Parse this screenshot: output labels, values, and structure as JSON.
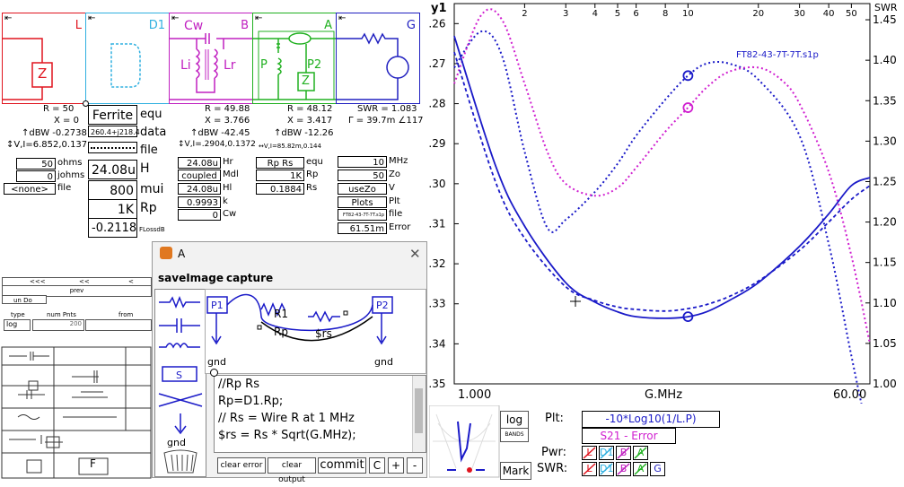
{
  "blocks": [
    {
      "title": "L",
      "color": "#e0141e"
    },
    {
      "title": "D1",
      "color": "#30b0e0"
    },
    {
      "title": "B",
      "color": "#c020c0"
    },
    {
      "title": "A",
      "color": "#20b020"
    },
    {
      "title": "G",
      "color": "#2020c0"
    }
  ],
  "block_labels": {
    "cw": "Cw",
    "li": "Li",
    "lr": "Lr",
    "p": "P",
    "p2": "P2",
    "z": "Z"
  },
  "results": {
    "L": [
      "R = 50",
      "X = 0",
      "↑dBW -0.2738",
      "↕V,I=6.852,0.137"
    ],
    "B": [
      "R = 49.88",
      "X = 3.766",
      "↑dBW -42.45",
      "↕V,I=.2904,0.1372"
    ],
    "A": [
      "R = 48.12",
      "X = 3.417",
      "↑dBW -12.26",
      "↔V,I=85.82m,0.144"
    ],
    "G": [
      "SWR = 1.083",
      "Γ = 39.7m ∠117"
    ]
  },
  "L_params": [
    {
      "value": "50",
      "unit": "ohms"
    },
    {
      "value": "0",
      "unit": "johms"
    },
    {
      "value": "<none>",
      "unit": "file"
    }
  ],
  "D1_params": {
    "material": "Ferrite",
    "material_unit": "equ",
    "data": "260.4+j218.4",
    "data_unit": "data",
    "file_unit": "file",
    "H": "24.08u",
    "H_unit": "H",
    "mui": "800",
    "mui_unit": "mui",
    "Rp": "1K",
    "Rp_unit": "Rp",
    "loss": "-0.2118",
    "loss_unit": "FLossdB"
  },
  "B_params": [
    {
      "value": "24.08u",
      "unit": "Hr"
    },
    {
      "value": "coupled",
      "unit": "Mdl"
    },
    {
      "value": "24.08u",
      "unit": "Hl"
    },
    {
      "value": "0.9993",
      "unit": "k"
    },
    {
      "value": "0",
      "unit": "Cw"
    }
  ],
  "A_params": [
    {
      "value": "Rp Rs",
      "unit": "equ"
    },
    {
      "value": "1K",
      "unit": "Rp"
    },
    {
      "value": "0.1884",
      "unit": "Rs"
    }
  ],
  "G_params": [
    {
      "value": "10",
      "unit": "MHz"
    },
    {
      "value": "50",
      "unit": "Zo"
    },
    {
      "value": "useZo",
      "unit": "V"
    },
    {
      "value": "Plots",
      "unit": "Plt"
    },
    {
      "value": "FT82-43-7T-7T.s1p",
      "unit": "file"
    },
    {
      "value": "61.51m",
      "unit": "Error"
    }
  ],
  "left_panel": {
    "row1": [
      "<<<",
      "<<",
      "<"
    ],
    "prev": "prev",
    "undo": "un Do",
    "type_lbl": "type",
    "type_val": "log",
    "pnts_lbl": "num Pnts",
    "pnts_val": "200",
    "from_lbl": "from"
  },
  "dialog": {
    "title": "A",
    "menu": [
      "saveImage",
      "capture"
    ],
    "schem": {
      "p1": "P1",
      "p2": "P2",
      "r1": "R1",
      "rp": "Rp",
      "rs": "$rs",
      "gnd1": "gnd",
      "gnd2": "gnd"
    },
    "palette_s": "S",
    "palette_gnd": "gnd",
    "code": [
      "//Rp Rs",
      "Rp=D1.Rp;",
      "// Rs = Wire R at 1 MHz",
      "$rs = Rs * Sqrt(G.MHz);"
    ],
    "buttons": [
      "clear error",
      "clear output",
      "commit",
      "C",
      "+",
      "-"
    ]
  },
  "chart_data": {
    "type": "line",
    "x_scale": "log",
    "xlabel": "G.MHz",
    "x_range": [
      1.0,
      60.0
    ],
    "x_end_labels": [
      "1.000",
      "60.00"
    ],
    "x_ticks": [
      "2",
      "3",
      "4",
      "5",
      "6",
      "8",
      "10",
      "20",
      "30",
      "40",
      "50"
    ],
    "y1_label": "y1",
    "y1_range": [
      -0.35,
      -0.255
    ],
    "y1_ticks": [
      "-0.26",
      "-0.27",
      "-0.28",
      "-0.29",
      "-0.30",
      "-0.31",
      "-0.32",
      "-0.33",
      "-0.34",
      "-0.35"
    ],
    "y2_label": "SWR",
    "y2_range": [
      1.0,
      1.47
    ],
    "y2_ticks": [
      "1.45",
      "1.40",
      "1.35",
      "1.30",
      "1.25",
      "1.20",
      "1.15",
      "1.10",
      "1.05",
      "1.00"
    ],
    "annotation": "FT82-43-7T-7T.s1p",
    "marker_x": 10,
    "grid": false,
    "series": [
      {
        "name": "-10*Log10(1/L.P)",
        "axis": "y1",
        "style": "dotted",
        "color": "#1a1ac8",
        "x": [
          1.0,
          1.3,
          1.6,
          2.0,
          2.5,
          3.0,
          4.0,
          5.0,
          6.0,
          8.0,
          10,
          12,
          15,
          20,
          30,
          40,
          50,
          60
        ],
        "y": [
          -0.271,
          -0.262,
          -0.268,
          -0.292,
          -0.311,
          -0.309,
          -0.302,
          -0.295,
          -0.288,
          -0.279,
          -0.273,
          -0.27,
          -0.27,
          -0.274,
          -0.288,
          -0.315,
          -0.343,
          -0.365
        ]
      },
      {
        "name": "S21 - Error",
        "axis": "y1",
        "style": "dotted",
        "color": "#d020d0",
        "x": [
          1.0,
          1.3,
          1.6,
          2.0,
          2.5,
          3.0,
          4.0,
          5.0,
          6.0,
          8.0,
          10,
          12,
          15,
          20,
          25,
          30,
          40,
          50,
          60
        ],
        "y": [
          -0.275,
          -0.258,
          -0.259,
          -0.275,
          -0.292,
          -0.3,
          -0.303,
          -0.301,
          -0.296,
          -0.287,
          -0.281,
          -0.276,
          -0.272,
          -0.271,
          -0.274,
          -0.28,
          -0.297,
          -0.318,
          -0.34
        ]
      },
      {
        "name": "SWR",
        "axis": "y2",
        "style": "solid",
        "color": "#1a1ac8",
        "x": [
          1.0,
          1.5,
          2.0,
          3.0,
          4.0,
          5.0,
          6.0,
          8.0,
          10,
          12,
          15,
          20,
          30,
          40,
          50,
          60
        ],
        "y": [
          1.43,
          1.27,
          1.195,
          1.125,
          1.101,
          1.089,
          1.083,
          1.081,
          1.083,
          1.089,
          1.103,
          1.125,
          1.17,
          1.21,
          1.245,
          1.255
        ]
      },
      {
        "name": "SWR ref",
        "axis": "y2",
        "style": "dashed",
        "color": "#1a1ac8",
        "x": [
          1.0,
          1.5,
          2.0,
          3.0,
          4.0,
          5.0,
          6.0,
          8.0,
          10,
          12,
          15,
          20,
          30,
          40,
          50,
          60
        ],
        "y": [
          1.41,
          1.25,
          1.18,
          1.12,
          1.103,
          1.095,
          1.092,
          1.09,
          1.093,
          1.098,
          1.108,
          1.127,
          1.165,
          1.2,
          1.228,
          1.245
        ]
      }
    ]
  },
  "bottom": {
    "log": "log",
    "bands": "BANDS",
    "mark": "Mark",
    "plt_lbl": "Plt:",
    "plt1": "-10*Log10(1/L.P)",
    "plt2": "S21 - Error",
    "pwr_lbl": "Pwr:",
    "swr_lbl": "SWR:",
    "pwr_items": [
      "L",
      "D1",
      "B",
      "A"
    ],
    "swr_items": [
      "L",
      "D1",
      "B",
      "A",
      "G"
    ],
    "colors": {
      "L": "#e0141e",
      "D1": "#30b0e0",
      "B": "#c020c0",
      "A": "#20b020",
      "G": "#2020c0"
    }
  }
}
